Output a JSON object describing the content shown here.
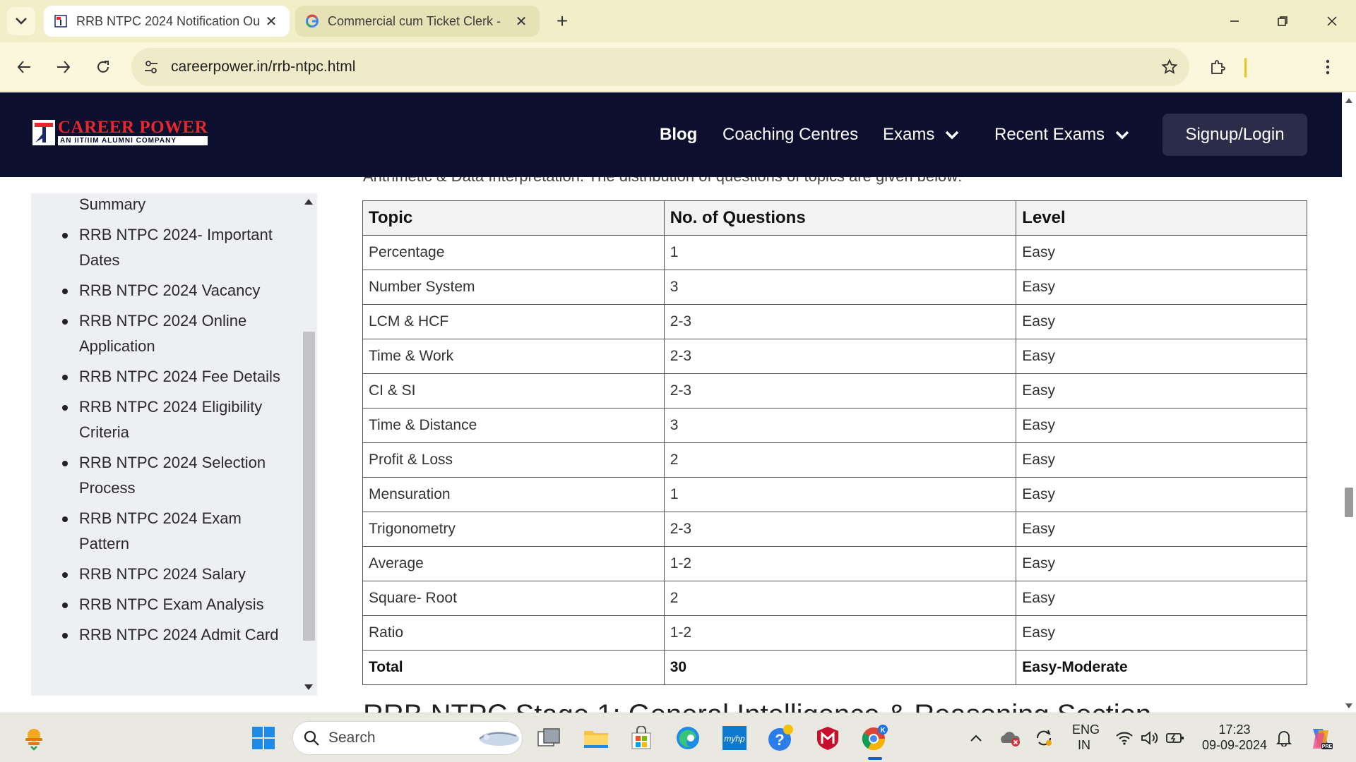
{
  "browser": {
    "tabs": [
      {
        "title": "RRB NTPC 2024 Notification Ou",
        "active": true
      },
      {
        "title": "Commercial cum Ticket Clerk - ",
        "active": false
      }
    ],
    "url": "careerpower.in/rrb-ntpc.html"
  },
  "site": {
    "logo": {
      "name": "CAREER POWER",
      "tagline": "AN IIT/IIM ALUMNI COMPANY"
    },
    "nav": {
      "blog": "Blog",
      "coaching": "Coaching Centres",
      "exams": "Exams",
      "recent_exams": "Recent Exams",
      "signup": "Signup/Login"
    }
  },
  "content": {
    "cut_top_text": "Arithmetic & Data Interpretation. The distribution of questions of topics are given below:",
    "cut_bottom_text": "RRB NTPC Stage 1: General Intelligence & Reasoning Section"
  },
  "sidebar": {
    "items": [
      {
        "label": "Summary",
        "bullet": false
      },
      {
        "label": "RRB NTPC 2024- Important Dates",
        "bullet": true
      },
      {
        "label": "RRB NTPC 2024 Vacancy",
        "bullet": true
      },
      {
        "label": "RRB NTPC 2024 Online Application",
        "bullet": true
      },
      {
        "label": "RRB NTPC 2024 Fee Details",
        "bullet": true
      },
      {
        "label": "RRB NTPC 2024 Eligibility Criteria",
        "bullet": true
      },
      {
        "label": "RRB NTPC 2024 Selection Process",
        "bullet": true
      },
      {
        "label": "RRB NTPC 2024 Exam Pattern",
        "bullet": true
      },
      {
        "label": "RRB NTPC 2024 Salary",
        "bullet": true
      },
      {
        "label": "RRB NTPC Exam Analysis",
        "bullet": true
      },
      {
        "label": "RRB NTPC 2024 Admit Card",
        "bullet": true
      }
    ]
  },
  "table": {
    "headers": [
      "Topic",
      "No. of Questions",
      "Level"
    ],
    "rows": [
      [
        "Percentage",
        "1",
        "Easy"
      ],
      [
        "Number System",
        "3",
        "Easy"
      ],
      [
        "LCM & HCF",
        "2-3",
        "Easy"
      ],
      [
        "Time & Work",
        "2-3",
        "Easy"
      ],
      [
        "CI & SI",
        "2-3",
        "Easy"
      ],
      [
        "Time & Distance",
        "3",
        "Easy"
      ],
      [
        "Profit & Loss",
        "2",
        "Easy"
      ],
      [
        "Mensuration",
        "1",
        "Easy"
      ],
      [
        "Trigonometry",
        "2-3",
        "Easy"
      ],
      [
        "Average",
        "1-2",
        "Easy"
      ],
      [
        "Square- Root",
        "2",
        "Easy"
      ],
      [
        "Ratio",
        "1-2",
        "Easy"
      ]
    ],
    "total": [
      "Total",
      "30",
      "Easy-Moderate"
    ]
  },
  "taskbar": {
    "search_label": "Search",
    "language": "ENG",
    "region": "IN",
    "time": "17:23",
    "date": "09-09-2024"
  },
  "colors": {
    "tabbar_bg": "#f2efc8",
    "header_bg": "#0d0f2e",
    "logo_red": "#e8272d",
    "signup_bg": "#2a2c4a"
  }
}
